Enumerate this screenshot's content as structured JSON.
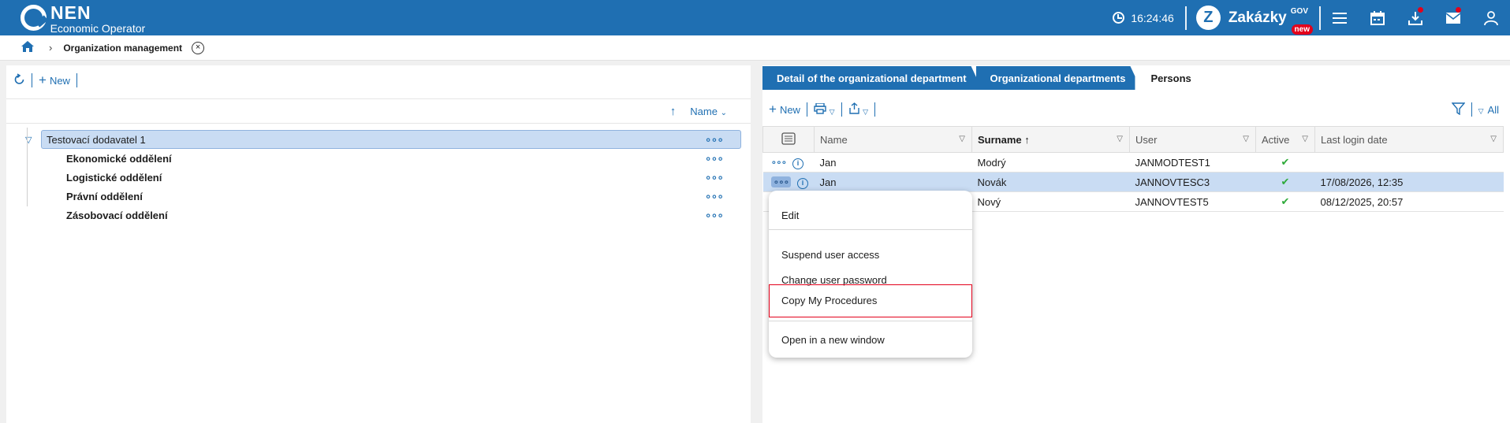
{
  "header": {
    "logo_text": "NEN",
    "logo_sub": "Economic Operator",
    "time": "16:24:46",
    "zakazky_letter": "Z",
    "zakazky_label": "Zakázky",
    "zakazky_sup": "GOV",
    "zakazky_badge": "new"
  },
  "breadcrumb": {
    "title": "Organization management"
  },
  "left": {
    "toolbar": {
      "new_label": "New"
    },
    "sort_label": "Name",
    "tree": {
      "root": "Testovací dodavatel 1",
      "children": [
        "Ekonomické oddělení",
        "Logistické oddělení",
        "Právní oddělení",
        "Zásobovací oddělení"
      ]
    }
  },
  "tabs": [
    "Detail of the organizational department",
    "Organizational departments",
    "Persons"
  ],
  "right": {
    "toolbar": {
      "new_label": "New",
      "filter_all": "All"
    },
    "columns": [
      "Name",
      "Surname",
      "User",
      "Active",
      "Last login date"
    ],
    "rows": [
      {
        "name": "Jan",
        "surname": "Modrý",
        "user": "JANMODTEST1",
        "active": "✔",
        "last_login": ""
      },
      {
        "name": "Jan",
        "surname": "Novák",
        "user": "JANNOVTESC3",
        "active": "✔",
        "last_login": "17/08/2026, 12:35"
      },
      {
        "name": "",
        "surname": "Nový",
        "user": "JANNOVTEST5",
        "active": "✔",
        "last_login": "08/12/2025, 20:57"
      }
    ]
  },
  "context_menu": {
    "items": [
      "Edit",
      "Suspend user access",
      "Change user password",
      "Copy My Procedures",
      "Open in a new window"
    ]
  },
  "colors": {
    "brand": "#1f6fb2",
    "selection": "#c9dcf3",
    "highlight": "#e3001b",
    "active_check": "#2eaa3a"
  }
}
